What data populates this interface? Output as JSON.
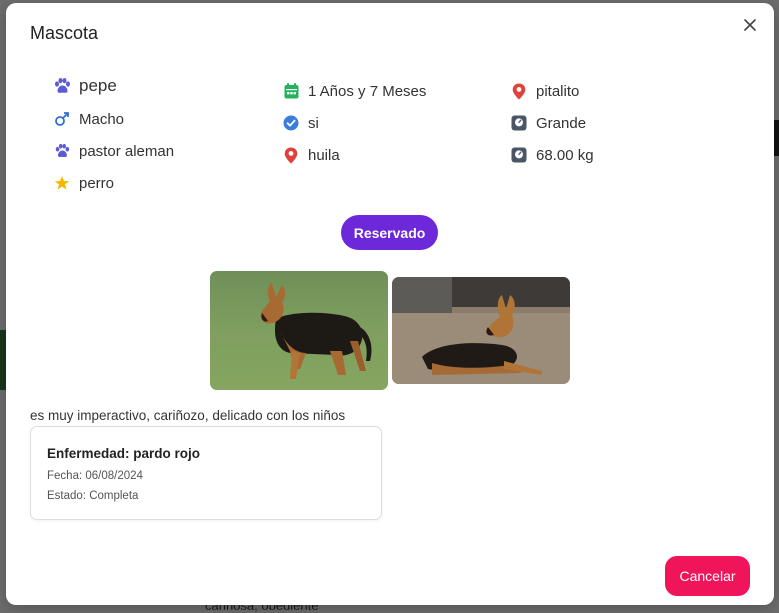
{
  "modal": {
    "title": "Mascota",
    "close_label": "×"
  },
  "pet": {
    "name": "pepe",
    "sex": "Macho",
    "breed": "pastor aleman",
    "species": "perro",
    "age": "1 Años y 7 Meses",
    "vaccinated": "si",
    "department": "huila",
    "city": "pitalito",
    "size": "Grande",
    "weight": "68.00 kg",
    "status": "Reservado",
    "description": "es muy imperactivo, cariñozo, delicado con los niños"
  },
  "disease_card": {
    "title": "Enfermedad: pardo rojo",
    "date": "Fecha: 06/08/2024",
    "state": "Estado: Completa"
  },
  "footer": {
    "cancel_label": "Cancelar"
  },
  "background": {
    "bottom_text": "cariñosa, obediente"
  },
  "colors": {
    "paw": "#5b5bd6",
    "male": "#2f6fd6",
    "star": "#f5b800",
    "calendar": "#22b35a",
    "check": "#3b7ddd",
    "location": "#e0413a",
    "scale": "#4a5666",
    "status_pill": "#6d28d9",
    "cancel": "#f0145a"
  },
  "icons": {
    "name": "paw-icon",
    "sex": "male-icon",
    "breed": "paw-icon",
    "species": "star-icon",
    "age": "calendar-icon",
    "vaccinated": "check-circle-icon",
    "department": "location-pin-icon",
    "city": "location-pin-icon",
    "size": "scale-icon",
    "weight": "scale-icon"
  }
}
